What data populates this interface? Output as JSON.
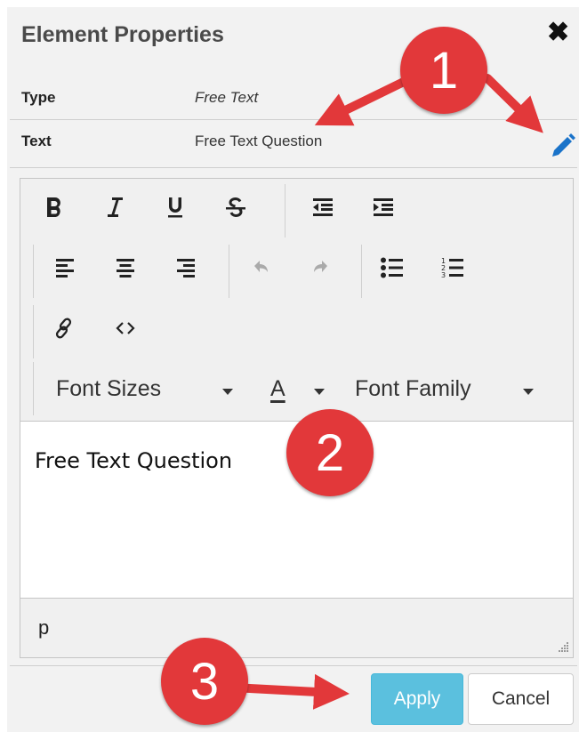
{
  "header": {
    "title": "Element Properties",
    "close_glyph": "✖"
  },
  "properties": [
    {
      "label": "Type",
      "value": "Free Text"
    },
    {
      "label": "Text",
      "value": "Free Text Question"
    }
  ],
  "toolbar": {
    "rows": [
      [
        "bold-icon",
        "italic-icon",
        "underline-icon",
        "strikethrough-icon",
        "outdent-icon",
        "indent-icon"
      ],
      [
        "align-left-icon",
        "align-center-icon",
        "align-right-icon",
        "undo-icon",
        "redo-icon",
        "bullet-list-icon",
        "numbered-list-icon"
      ],
      [
        "link-icon",
        "code-icon"
      ]
    ],
    "font_sizes_label": "Font Sizes",
    "text_color_label": "A",
    "font_family_label": "Font Family"
  },
  "editor": {
    "content": "Free Text Question",
    "status_path": "p"
  },
  "footer": {
    "apply_label": "Apply",
    "cancel_label": "Cancel"
  },
  "callouts": [
    "1",
    "2",
    "3"
  ],
  "colors": {
    "callout_red": "#e2383a",
    "apply_blue": "#5bc0de",
    "pencil_blue": "#1a73c9"
  }
}
